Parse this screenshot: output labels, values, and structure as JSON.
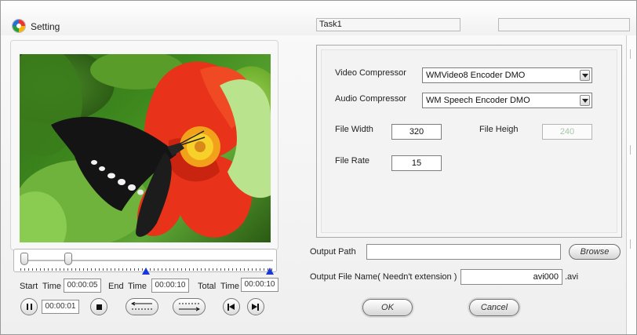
{
  "window": {
    "title": "Setting",
    "task_name": "Task1",
    "task_field_2": ""
  },
  "timeline": {
    "start_label": "Start",
    "end_label": "End",
    "total_label": "Total",
    "time_word": "Time",
    "start_time": "00:00:05",
    "end_time": "00:00:10",
    "total_time": "00:00:10",
    "current_time": "00:00:01",
    "thumb_start_fraction": 0.0,
    "thumb_current_fraction": 0.1,
    "end_marker_fraction": 0.5,
    "total_marker_fraction": 1.0
  },
  "settings": {
    "video_compressor_label": "Video Compressor",
    "video_compressor_value": "WMVideo8 Encoder DMO",
    "audio_compressor_label": "Audio Compressor",
    "audio_compressor_value": "WM Speech Encoder DMO",
    "file_width_label": "File Width",
    "file_width_value": "320",
    "file_height_label": "File Heigh",
    "file_height_value": "240",
    "file_rate_label": "File Rate",
    "file_rate_value": "15"
  },
  "output": {
    "path_label": "Output  Path",
    "path_value": "",
    "browse_label": "Browse",
    "name_label": "Output  File  Name( Needn't extension )",
    "name_value": "avi000",
    "extension": ".avi"
  },
  "actions": {
    "ok_label": "OK",
    "cancel_label": "Cancel"
  },
  "icons": {
    "app": "app-logo-icon",
    "pause": "pause-icon",
    "stop": "stop-icon",
    "set_start": "set-start-arrow-icon",
    "set_end": "set-end-arrow-icon",
    "prev": "skip-previous-icon",
    "next": "skip-next-icon",
    "dropdown": "chevron-down-icon"
  },
  "colors": {
    "marker": "#1a36d8",
    "disabled_text": "#a9c6a9"
  }
}
